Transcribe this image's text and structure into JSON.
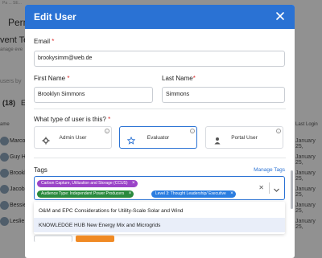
{
  "background": {
    "topline": "Pa ... SE...",
    "page_title": "Perm",
    "section_title": "vent Te",
    "section_subtitle": "anage eve",
    "users_label": "users by",
    "count_label": "(18)",
    "count_label2": "E",
    "header_name": "ame",
    "header_last_login": "Last Login",
    "rows": [
      {
        "name": "Marco",
        "date": "January 25,"
      },
      {
        "name": "Guy Ha",
        "date": "January 25,"
      },
      {
        "name": "Brookl",
        "date": "January 25,"
      },
      {
        "name": "Jacob",
        "date": "January 25,"
      },
      {
        "name": "Bessie",
        "date": "January 25,"
      },
      {
        "name": "Leslie A",
        "date": "January 25,"
      }
    ]
  },
  "modal": {
    "title": "Edit User",
    "close_icon": "close-icon",
    "email": {
      "label": "Email",
      "required_mark": "*",
      "value": "brookysimm@web.de"
    },
    "first_name": {
      "label": "First Name",
      "required_mark": "*",
      "value": "Brooklyn Simmons"
    },
    "last_name": {
      "label": "Last Name",
      "required_mark": "*",
      "value": "Simmons"
    },
    "user_type": {
      "question": "What type of user is this?",
      "required_mark": "*",
      "options": [
        {
          "label": "Admin User",
          "icon": "gear-icon",
          "selected": false
        },
        {
          "label": "Evaluator",
          "icon": "star-icon",
          "selected": true
        },
        {
          "label": "Portal User",
          "icon": "person-icon",
          "selected": false
        }
      ],
      "info_glyph": "i"
    },
    "tags": {
      "label": "Tags",
      "manage_label": "Manage Tags",
      "selected": [
        {
          "label": "Carbon Capture, Utilization and Storage (CCUS)",
          "color": "#9b44c8"
        },
        {
          "label": "Audience Type: Independent Power Producers",
          "color": "#2a8a3e"
        },
        {
          "label": "Level 3: Thought Leadership/ Executive",
          "color": "#2b7de0"
        }
      ],
      "remove_glyph": "×",
      "clear_glyph": "✕"
    },
    "dropdown_options": [
      {
        "label": "O&M and EPC Considerations for Utility-Scale Solar and Wind",
        "highlighted": false
      },
      {
        "label": "KNOWLEDGE HUB New Energy Mix and Microgrids",
        "highlighted": true
      }
    ],
    "accent_color": "#2a72d4",
    "button_color": "#f08a24"
  }
}
